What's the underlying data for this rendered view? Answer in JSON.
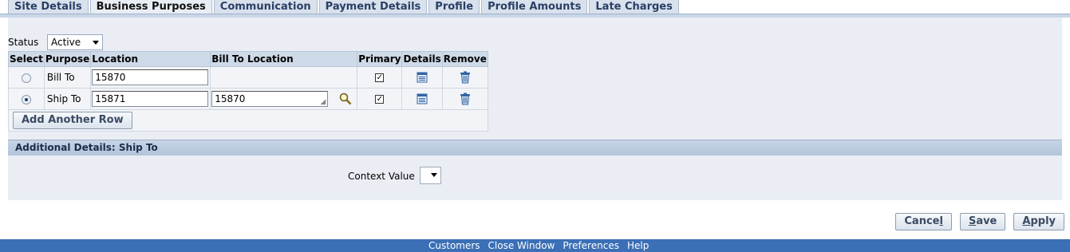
{
  "tabs": [
    {
      "label": "Site Details",
      "active": false
    },
    {
      "label": "Business Purposes",
      "active": true
    },
    {
      "label": "Communication",
      "active": false
    },
    {
      "label": "Payment Details",
      "active": false
    },
    {
      "label": "Profile",
      "active": false
    },
    {
      "label": "Profile Amounts",
      "active": false
    },
    {
      "label": "Late Charges",
      "active": false
    }
  ],
  "status": {
    "label": "Status",
    "value": "Active"
  },
  "table": {
    "headers": {
      "select": "Select",
      "purpose": "Purpose",
      "location": "Location",
      "bill_to_location": "Bill To Location",
      "primary": "Primary",
      "details": "Details",
      "remove": "Remove"
    },
    "rows": [
      {
        "selected": false,
        "purpose": "Bill To",
        "location": "15870",
        "bill_to_location": "",
        "primary": true
      },
      {
        "selected": true,
        "purpose": "Ship To",
        "location": "15871",
        "bill_to_location": "15870",
        "primary": true
      }
    ],
    "add_row_label": "Add Another Row"
  },
  "additional": {
    "header": "Additional Details: Ship To",
    "context_label": "Context Value",
    "context_value": ""
  },
  "buttons": {
    "cancel_pre": "Cance",
    "cancel_key": "l",
    "cancel_post": "",
    "save_pre": "",
    "save_key": "S",
    "save_post": "ave",
    "apply_pre": "",
    "apply_key": "A",
    "apply_post": "pply"
  },
  "footer": {
    "links": [
      "Customers",
      "Close Window",
      "Preferences",
      "Help"
    ]
  },
  "colors": {
    "footer_bg": "#3b6fb6",
    "panel_bg": "#eaeef4",
    "header_bg": "#cfdae8"
  },
  "icons": {
    "search": "magnifier-icon",
    "details": "details-icon",
    "remove": "trash-icon"
  }
}
